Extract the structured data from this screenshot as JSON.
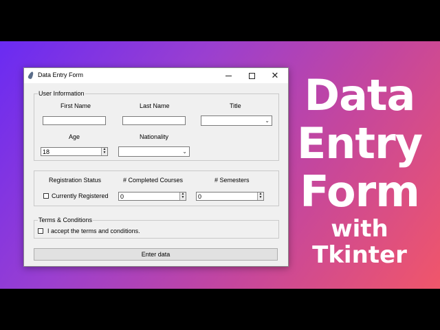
{
  "banner": {
    "headline_lines": [
      "Data",
      "Entry",
      "Form",
      "with",
      "Tkinter"
    ],
    "gradient_colors": [
      "#6a2bf2",
      "#c4469e",
      "#f0566a"
    ]
  },
  "window": {
    "title": "Data Entry Form",
    "controls": [
      "minimize",
      "maximize",
      "close"
    ],
    "close_glyph": "✕"
  },
  "user_info": {
    "legend": "User Information",
    "first_name_label": "First Name",
    "last_name_label": "Last Name",
    "title_label": "Title",
    "age_label": "Age",
    "nationality_label": "Nationality",
    "first_name_value": "",
    "last_name_value": "",
    "title_value": "",
    "age_value": "18",
    "nationality_value": ""
  },
  "courses": {
    "registration_label": "Registration Status",
    "completed_label": "# Completed Courses",
    "semesters_label": "# Semesters",
    "registered_checkbox_label": "Currently Registered",
    "registered_checked": false,
    "completed_value": "0",
    "semesters_value": "0"
  },
  "terms": {
    "legend": "Terms & Conditions",
    "accept_label": "I accept the terms and conditions.",
    "accept_checked": false
  },
  "submit_label": "Enter data"
}
